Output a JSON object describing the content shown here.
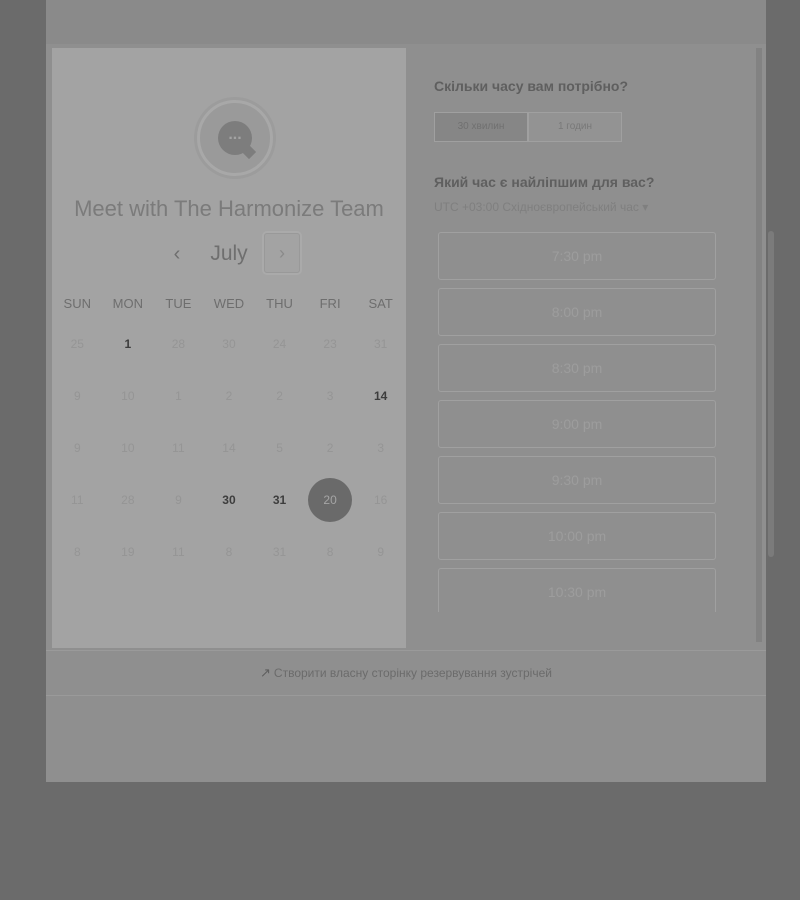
{
  "header": {
    "title": ""
  },
  "host": {
    "title": "Meet with The Harmonize Team",
    "avatar_icon": "chat-bubble-icon",
    "avatar_text": "..."
  },
  "calendar": {
    "month": "July",
    "prev_icon": "‹",
    "next_icon": "›",
    "weekdays": [
      "SUN",
      "MON",
      "TUE",
      "WED",
      "THU",
      "FRI",
      "SAT"
    ],
    "weeks": [
      [
        {
          "d": "25",
          "a": false
        },
        {
          "d": "1",
          "a": true
        },
        {
          "d": "28",
          "a": false
        },
        {
          "d": "30",
          "a": false
        },
        {
          "d": "24",
          "a": false
        },
        {
          "d": "23",
          "a": false
        },
        {
          "d": "31",
          "a": false
        }
      ],
      [
        {
          "d": "9",
          "a": false
        },
        {
          "d": "10",
          "a": false
        },
        {
          "d": "1",
          "a": false
        },
        {
          "d": "2",
          "a": false
        },
        {
          "d": "2",
          "a": false
        },
        {
          "d": "3",
          "a": false
        },
        {
          "d": "14",
          "a": true
        }
      ],
      [
        {
          "d": "9",
          "a": false
        },
        {
          "d": "10",
          "a": false
        },
        {
          "d": "11",
          "a": false
        },
        {
          "d": "14",
          "a": false
        },
        {
          "d": "5",
          "a": false
        },
        {
          "d": "2",
          "a": false
        },
        {
          "d": "3",
          "a": false
        }
      ],
      [
        {
          "d": "11",
          "a": false
        },
        {
          "d": "28",
          "a": false
        },
        {
          "d": "9",
          "a": false
        },
        {
          "d": "30",
          "a": true
        },
        {
          "d": "31",
          "a": true
        },
        {
          "d": "20",
          "a": true,
          "s": true
        },
        {
          "d": "16",
          "a": false
        }
      ],
      [
        {
          "d": "8",
          "a": false
        },
        {
          "d": "19",
          "a": false
        },
        {
          "d": "11",
          "a": false
        },
        {
          "d": "8",
          "a": false
        },
        {
          "d": "31",
          "a": false
        },
        {
          "d": "8",
          "a": false
        },
        {
          "d": "9",
          "a": false
        }
      ]
    ]
  },
  "booking": {
    "duration_question": "Скільки часу вам потрібно?",
    "durations": [
      "30 хвилин",
      "1 годин"
    ],
    "time_question": "Який час є найліпшим для вас?",
    "timezone": "UTC +03:00 Східноєвропейський час",
    "timezone_icon": "▾",
    "slots": [
      "7:30 pm",
      "8:00 pm",
      "8:30 pm",
      "9:00 pm",
      "9:30 pm",
      "10:00 pm",
      "10:30 pm"
    ]
  },
  "footer": {
    "icon": "↗",
    "link_text": "Створити власну сторінку резервування зустрічей"
  }
}
